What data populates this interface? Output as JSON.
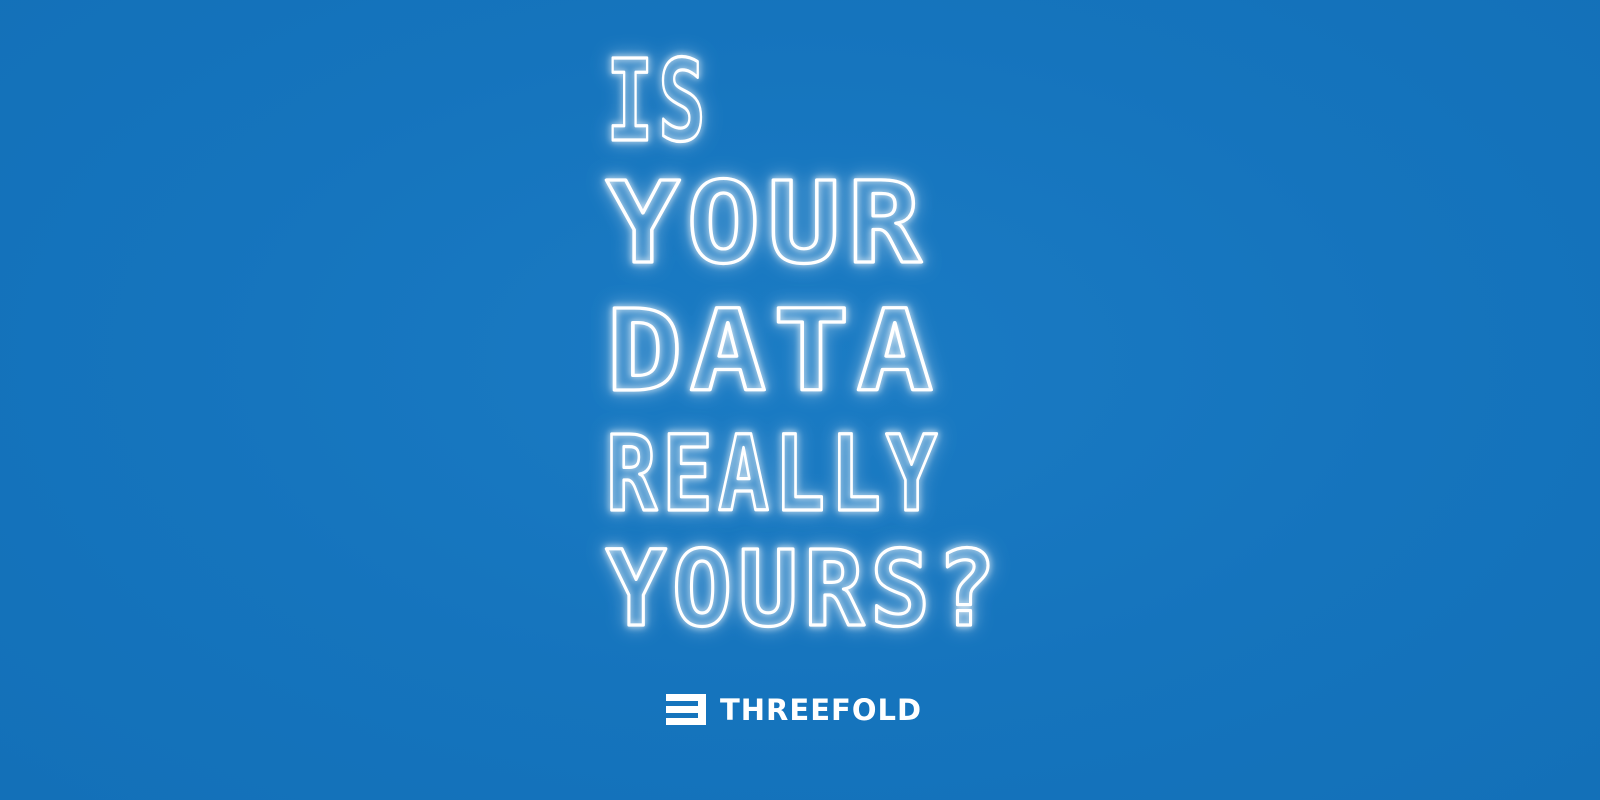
{
  "headline": {
    "lines": [
      "IS",
      "YOUR",
      "DATA",
      "REALLY",
      "YOURS?"
    ]
  },
  "brand": {
    "name": "THREEFOLD",
    "logo_icon": "threefold-logo-icon"
  },
  "colors": {
    "background": "#1574bd",
    "neon": "#ffffff"
  }
}
